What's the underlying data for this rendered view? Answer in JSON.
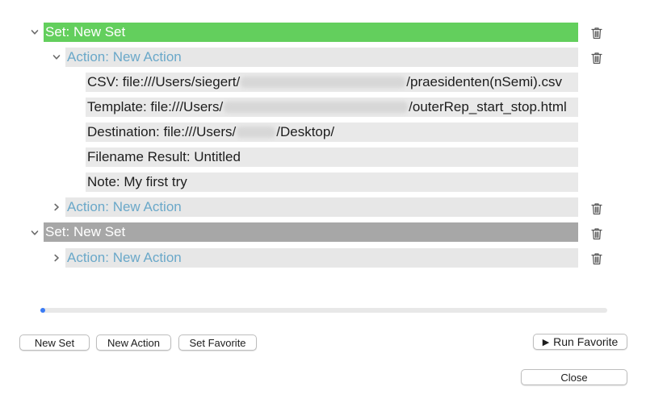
{
  "tree": {
    "rows": [
      {
        "kind": "set",
        "label": "Set: New Set",
        "expanded": true
      },
      {
        "kind": "action",
        "label": "Action: New Action",
        "expanded": true
      },
      {
        "kind": "detail",
        "prefix": "CSV: file:///Users/siegert/",
        "suffix": "/praesidenten(nSemi).csv"
      },
      {
        "kind": "detail",
        "prefix": "Template: file:///Users/",
        "suffix": "/outerRep_start_stop.html"
      },
      {
        "kind": "detail",
        "prefix": "Destination: file:///Users/",
        "suffix": "/Desktop/"
      },
      {
        "kind": "detail",
        "label": "Filename Result: Untitled"
      },
      {
        "kind": "detail",
        "label": "Note: My first try"
      },
      {
        "kind": "action",
        "label": "Action: New Action",
        "expanded": false
      },
      {
        "kind": "set",
        "label": "Set: New Set",
        "expanded": true
      },
      {
        "kind": "action",
        "label": "Action: New Action",
        "expanded": false
      }
    ]
  },
  "buttons": {
    "new_set": "New Set",
    "new_action": "New Action",
    "set_favorite": "Set Favorite",
    "run_favorite": "Run Favorite",
    "close": "Close"
  },
  "icons": {
    "delete": "trash-icon",
    "expand": "chevron-down-icon",
    "collapse": "chevron-right-icon",
    "play": "play-icon"
  },
  "colors": {
    "selected_set": "#63cf5d",
    "inactive_set": "#a7a7a7",
    "action_text": "#6aa8c9",
    "progress": "#3a7bf5"
  },
  "progress": {
    "value": 0
  }
}
